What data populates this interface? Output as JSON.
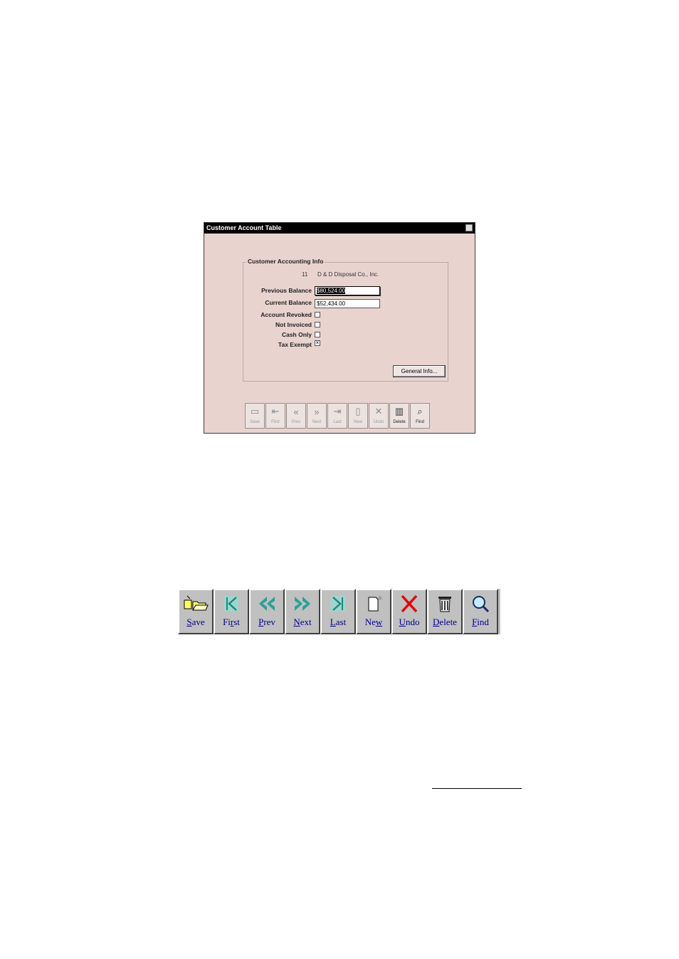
{
  "window": {
    "title": "Customer Account Table",
    "group_label": "Customer Accounting Info",
    "account_id": "11",
    "account_name": "D & D Disposal Co., Inc.",
    "fields": {
      "previous_balance_label": "Previous Balance",
      "previous_balance_value": "$80,524.00",
      "current_balance_label": "Current Balance",
      "current_balance_value": "$52,434.00"
    },
    "checkboxes": [
      {
        "label": "Account Revoked",
        "checked": false
      },
      {
        "label": "Not Invoiced",
        "checked": false
      },
      {
        "label": "Cash Only",
        "checked": false
      },
      {
        "label": "Tax Exempt",
        "checked": true
      }
    ],
    "general_info_button": "General Info...",
    "mini_toolbar": [
      "Save",
      "First",
      "Prev",
      "Next",
      "Last",
      "New",
      "Undo",
      "Delete",
      "Find"
    ]
  },
  "toolbar": {
    "buttons": [
      {
        "label": "Save",
        "icon": "folder-save-icon"
      },
      {
        "label": "First",
        "icon": "first-record-icon"
      },
      {
        "label": "Prev",
        "icon": "prev-record-icon"
      },
      {
        "label": "Next",
        "icon": "next-record-icon"
      },
      {
        "label": "Last",
        "icon": "last-record-icon"
      },
      {
        "label": "New",
        "icon": "new-document-icon"
      },
      {
        "label": "Undo",
        "icon": "undo-x-icon"
      },
      {
        "label": "Delete",
        "icon": "trash-icon"
      },
      {
        "label": "Find",
        "icon": "magnifier-icon"
      }
    ]
  },
  "colors": {
    "dialog_bg": "#e8d3cf",
    "toolbar_bg": "#c0c0c0",
    "label_blue": "#00008b",
    "undo_red": "#e00000",
    "nav_teal": "#2aa198"
  }
}
